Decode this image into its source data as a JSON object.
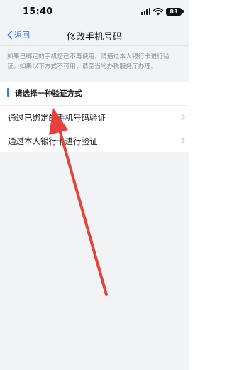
{
  "status_bar": {
    "time": "15:40",
    "battery": "83",
    "icons": [
      "signal-icon",
      "wifi-icon",
      "battery-icon"
    ]
  },
  "nav": {
    "back_label": "返回",
    "title": "修改手机号码",
    "back_icon": "chevron-left-icon"
  },
  "notice": {
    "text": "如果已绑定的手机您已不再使用，请通过本人银行卡进行验证。如果以下方式不可用，请至当地办税服务厅办理。"
  },
  "section": {
    "title": "请选择一种验证方式"
  },
  "options": [
    {
      "label": "通过已绑定的手机号码验证",
      "icon": "chevron-right-icon"
    },
    {
      "label": "通过本人银行卡进行验证",
      "icon": "chevron-right-icon"
    }
  ],
  "colors": {
    "accent": "#2f7ef5",
    "background": "#f2f3f5",
    "annotation_arrow": "#e8403a"
  }
}
